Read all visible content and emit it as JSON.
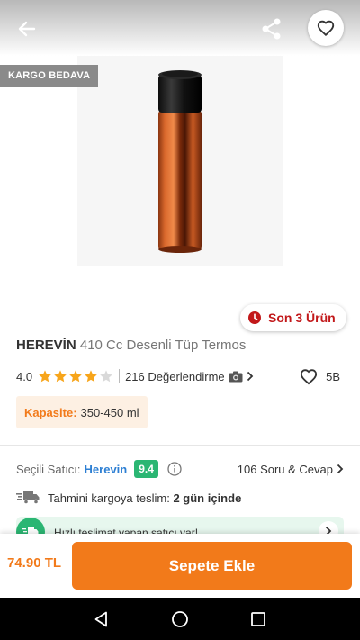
{
  "badges": {
    "cargo": "KARGO BEDAVA",
    "stock": "Son 3 Ürün"
  },
  "product": {
    "brand": "HEREVİN",
    "name": "410 Cc Desenli Tüp Termos",
    "rating": "4.0",
    "stars_filled": 4,
    "stars_total": 5,
    "reviews": "216 Değerlendirme",
    "favorites": "5B",
    "capacity_label": "Kapasite:",
    "capacity_value": "350-450 ml"
  },
  "seller": {
    "label": "Seçili Satıcı:",
    "name": "Herevin",
    "score": "9.4",
    "qa": "106 Soru & Cevap"
  },
  "delivery": {
    "label": "Tahmini kargoya teslim:",
    "value": "2 gün içinde"
  },
  "fast_banner": {
    "text": "Hızlı teslimat yapan satıcı var!"
  },
  "purchase": {
    "price": "74.90 TL",
    "button": "Sepete Ekle"
  },
  "colors": {
    "accent": "#f27a1a",
    "seller_score": "#2bb673",
    "stock": "#c2181a",
    "star": "#f7a51b"
  },
  "icons": [
    "back-arrow-icon",
    "share-icon",
    "heart-icon",
    "clock-icon",
    "star-icon",
    "camera-icon",
    "chevron-right-icon",
    "info-icon",
    "truck-icon",
    "fast-delivery-icon",
    "nav-back-icon",
    "nav-home-icon",
    "nav-recents-icon"
  ]
}
